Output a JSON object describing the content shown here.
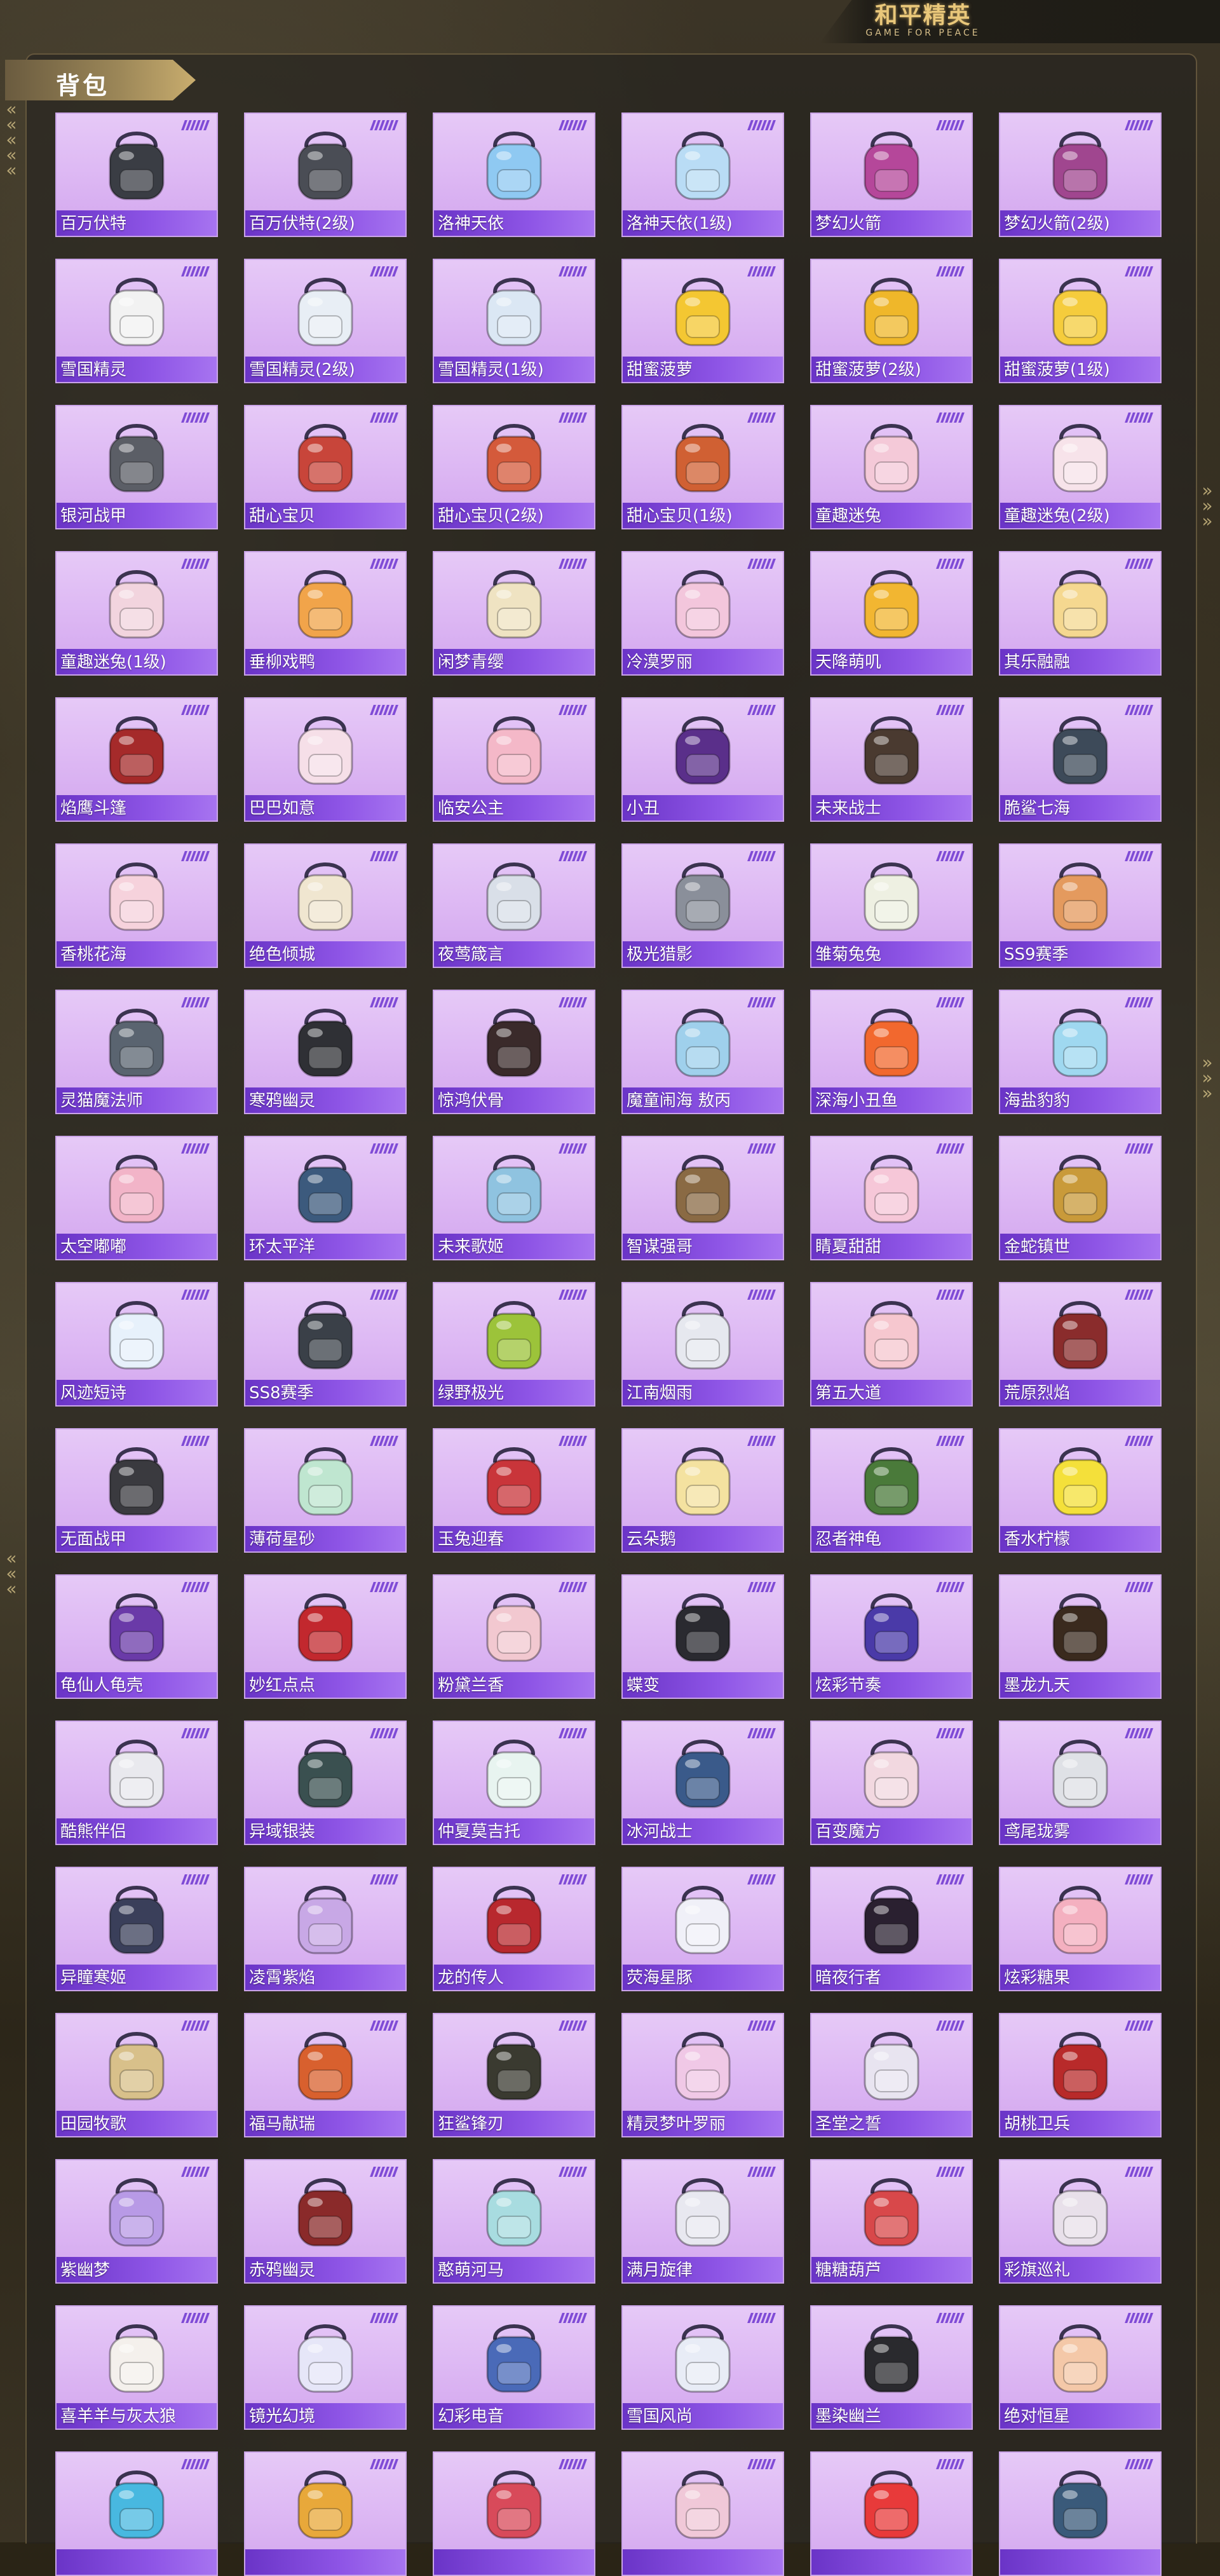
{
  "header": {
    "logo_main": "和平精英",
    "logo_sub": "GAME FOR PEACE"
  },
  "panel": {
    "title": "背包"
  },
  "items": [
    {
      "name": "百万伏特",
      "color": "#3a3d44"
    },
    {
      "name": "百万伏特(2级)",
      "color": "#4a4d55"
    },
    {
      "name": "洛神天依",
      "color": "#8fc9f2"
    },
    {
      "name": "洛神天依(1级)",
      "color": "#b9dcf5"
    },
    {
      "name": "梦幻火箭",
      "color": "#b5479a"
    },
    {
      "name": "梦幻火箭(2级)",
      "color": "#a0468f"
    },
    {
      "name": "雪国精灵",
      "color": "#f2f2f2"
    },
    {
      "name": "雪国精灵(2级)",
      "color": "#e8eef5"
    },
    {
      "name": "雪国精灵(1级)",
      "color": "#dbe7f4"
    },
    {
      "name": "甜蜜菠萝",
      "color": "#f4c732"
    },
    {
      "name": "甜蜜菠萝(2级)",
      "color": "#efb72a"
    },
    {
      "name": "甜蜜菠萝(1级)",
      "color": "#f5cc3c"
    },
    {
      "name": "银河战甲",
      "color": "#5b5e66"
    },
    {
      "name": "甜心宝贝",
      "color": "#c8453a"
    },
    {
      "name": "甜心宝贝(2级)",
      "color": "#d45a3b"
    },
    {
      "name": "甜心宝贝(1级)",
      "color": "#d06033"
    },
    {
      "name": "童趣迷兔",
      "color": "#f4c9d8"
    },
    {
      "name": "童趣迷兔(2级)",
      "color": "#f7e3ea"
    },
    {
      "name": "童趣迷兔(1级)",
      "color": "#f2d4de"
    },
    {
      "name": "垂柳戏鸭",
      "color": "#f1a44a"
    },
    {
      "name": "闲梦青缨",
      "color": "#efe3c2"
    },
    {
      "name": "冷漠罗丽",
      "color": "#f3c6dc"
    },
    {
      "name": "天降萌叽",
      "color": "#f2b631"
    },
    {
      "name": "其乐融融",
      "color": "#f5d890"
    },
    {
      "name": "焰鹰斗篷",
      "color": "#a52a2a"
    },
    {
      "name": "巴巴如意",
      "color": "#f6dfe8"
    },
    {
      "name": "临安公主",
      "color": "#f4b8c8"
    },
    {
      "name": "小丑",
      "color": "#5a2f8a"
    },
    {
      "name": "未来战士",
      "color": "#4a3a30"
    },
    {
      "name": "脆鲨七海",
      "color": "#3d4a59"
    },
    {
      "name": "香桃花海",
      "color": "#f6d2dc"
    },
    {
      "name": "绝色倾城",
      "color": "#f0e6d0"
    },
    {
      "name": "夜莺箴言",
      "color": "#d9dfe8"
    },
    {
      "name": "极光猎影",
      "color": "#8a8f9a"
    },
    {
      "name": "雏菊兔兔",
      "color": "#eef0e2"
    },
    {
      "name": "SS9赛季",
      "color": "#e49a5e"
    },
    {
      "name": "灵猫魔法师",
      "color": "#5a6470"
    },
    {
      "name": "寒鸦幽灵",
      "color": "#2f3035"
    },
    {
      "name": "惊鸿伏骨",
      "color": "#3a2a2a"
    },
    {
      "name": "魔童闹海 敖丙",
      "color": "#9fd0ec"
    },
    {
      "name": "深海小丑鱼",
      "color": "#f2682e"
    },
    {
      "name": "海盐豹豹",
      "color": "#9fd8f0"
    },
    {
      "name": "太空嘟嘟",
      "color": "#f2b4c8"
    },
    {
      "name": "环太平洋",
      "color": "#3c5a7d"
    },
    {
      "name": "未来歌姬",
      "color": "#8fc3e0"
    },
    {
      "name": "智谋强哥",
      "color": "#8a6a44"
    },
    {
      "name": "睛夏甜甜",
      "color": "#f6c7d8"
    },
    {
      "name": "金蛇镇世",
      "color": "#c99a3a"
    },
    {
      "name": "风迹短诗",
      "color": "#e7f1fb"
    },
    {
      "name": "SS8赛季",
      "color": "#3a4048"
    },
    {
      "name": "绿野极光",
      "color": "#9cc33a"
    },
    {
      "name": "江南烟雨",
      "color": "#e6e8ef"
    },
    {
      "name": "第五大道",
      "color": "#f6c7cf"
    },
    {
      "name": "荒原烈焰",
      "color": "#8a2c2c"
    },
    {
      "name": "无面战甲",
      "color": "#3a3a3f"
    },
    {
      "name": "薄荷星砂",
      "color": "#bfe6d0"
    },
    {
      "name": "玉兔迎春",
      "color": "#c9353a"
    },
    {
      "name": "云朵鹅",
      "color": "#f4e2a0"
    },
    {
      "name": "忍者神龟",
      "color": "#4a7a3a"
    },
    {
      "name": "香水柠檬",
      "color": "#f4e03a"
    },
    {
      "name": "龟仙人龟壳",
      "color": "#6a3aa8"
    },
    {
      "name": "妙红点点",
      "color": "#c2282e"
    },
    {
      "name": "粉黛兰香",
      "color": "#f2c8d0"
    },
    {
      "name": "蝶变",
      "color": "#2a2a30"
    },
    {
      "name": "炫彩节奏",
      "color": "#4a3aa8"
    },
    {
      "name": "墨龙九天",
      "color": "#3a2a1e"
    },
    {
      "name": "酷熊伴侣",
      "color": "#e9e9ee"
    },
    {
      "name": "异域银装",
      "color": "#3a5050"
    },
    {
      "name": "仲夏莫吉托",
      "color": "#e8f4f0"
    },
    {
      "name": "冰河战士",
      "color": "#3a5a8a"
    },
    {
      "name": "百变魔方",
      "color": "#f2d8e0"
    },
    {
      "name": "鸢尾珑雾",
      "color": "#dfe1e6"
    },
    {
      "name": "异瞳寒姬",
      "color": "#3a3f5a"
    },
    {
      "name": "凌霄紫焰",
      "color": "#c8a8e6"
    },
    {
      "name": "龙的传人",
      "color": "#b8282e"
    },
    {
      "name": "荧海星豚",
      "color": "#f0f0f8"
    },
    {
      "name": "暗夜行者",
      "color": "#2a2030"
    },
    {
      "name": "炫彩糖果",
      "color": "#f4b0c0"
    },
    {
      "name": "田园牧歌",
      "color": "#d8c08a"
    },
    {
      "name": "福马献瑞",
      "color": "#d8602e"
    },
    {
      "name": "狂鲨锋刃",
      "color": "#3a3a30"
    },
    {
      "name": "精灵梦叶罗丽",
      "color": "#f0c8e6"
    },
    {
      "name": "圣堂之誓",
      "color": "#e8e4f0"
    },
    {
      "name": "胡桃卫兵",
      "color": "#b82a2a"
    },
    {
      "name": "紫幽梦",
      "color": "#b89ae6"
    },
    {
      "name": "赤鸦幽灵",
      "color": "#8a2a2a"
    },
    {
      "name": "憨萌河马",
      "color": "#a8dce0"
    },
    {
      "name": "满月旋律",
      "color": "#e8e8f0"
    },
    {
      "name": "糖糖葫芦",
      "color": "#d8484a"
    },
    {
      "name": "彩旗巡礼",
      "color": "#e8e0ea"
    },
    {
      "name": "喜羊羊与灰太狼",
      "color": "#f4f0ec"
    },
    {
      "name": "镜光幻境",
      "color": "#e6e6f8"
    },
    {
      "name": "幻彩电音",
      "color": "#4a6ab8"
    },
    {
      "name": "雪国风尚",
      "color": "#e8ecf6"
    },
    {
      "name": "墨染幽兰",
      "color": "#2a2a2e"
    },
    {
      "name": "绝对恒星",
      "color": "#f4c8a8"
    },
    {
      "name": "",
      "color": "#48b8e0"
    },
    {
      "name": "",
      "color": "#e8a83a"
    },
    {
      "name": "",
      "color": "#d84a5a"
    },
    {
      "name": "",
      "color": "#f0c8d8"
    },
    {
      "name": "",
      "color": "#e83a3a"
    },
    {
      "name": "",
      "color": "#3a5a7a"
    }
  ]
}
